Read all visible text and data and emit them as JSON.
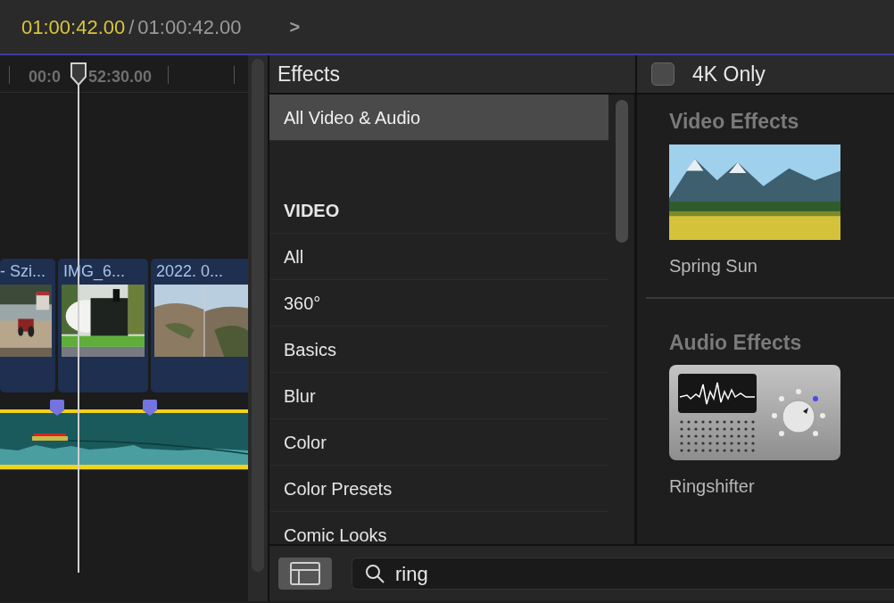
{
  "timecode": {
    "current": "01:00:42.00",
    "separator": "/",
    "total": "01:00:42.00",
    "forward": ">"
  },
  "timeline": {
    "ruler_labels": [
      "00:0",
      "52:30.00"
    ],
    "clips": [
      {
        "title": "- Szi..."
      },
      {
        "title": "IMG_6..."
      },
      {
        "title": "2022. 0..."
      }
    ]
  },
  "sidebar": {
    "title": "Effects",
    "items": [
      {
        "kind": "item",
        "label": "All Video & Audio",
        "selected": true
      },
      {
        "kind": "spacer"
      },
      {
        "kind": "header",
        "label": "VIDEO"
      },
      {
        "kind": "item",
        "label": "All",
        "selected": false
      },
      {
        "kind": "item",
        "label": "360°",
        "selected": false
      },
      {
        "kind": "item",
        "label": "Basics",
        "selected": false
      },
      {
        "kind": "item",
        "label": "Blur",
        "selected": false
      },
      {
        "kind": "item",
        "label": "Color",
        "selected": false
      },
      {
        "kind": "item",
        "label": "Color Presets",
        "selected": false
      },
      {
        "kind": "item",
        "label": "Comic Looks",
        "selected": false
      }
    ]
  },
  "browser": {
    "filter": {
      "label": "4K Only",
      "checked": false
    },
    "sections": [
      {
        "title": "Video Effects",
        "effects": [
          {
            "name": "Spring Sun",
            "kind": "picture"
          }
        ]
      },
      {
        "title": "Audio Effects",
        "effects": [
          {
            "name": "Ringshifter",
            "kind": "device"
          }
        ]
      }
    ]
  },
  "search": {
    "value": "ring"
  }
}
